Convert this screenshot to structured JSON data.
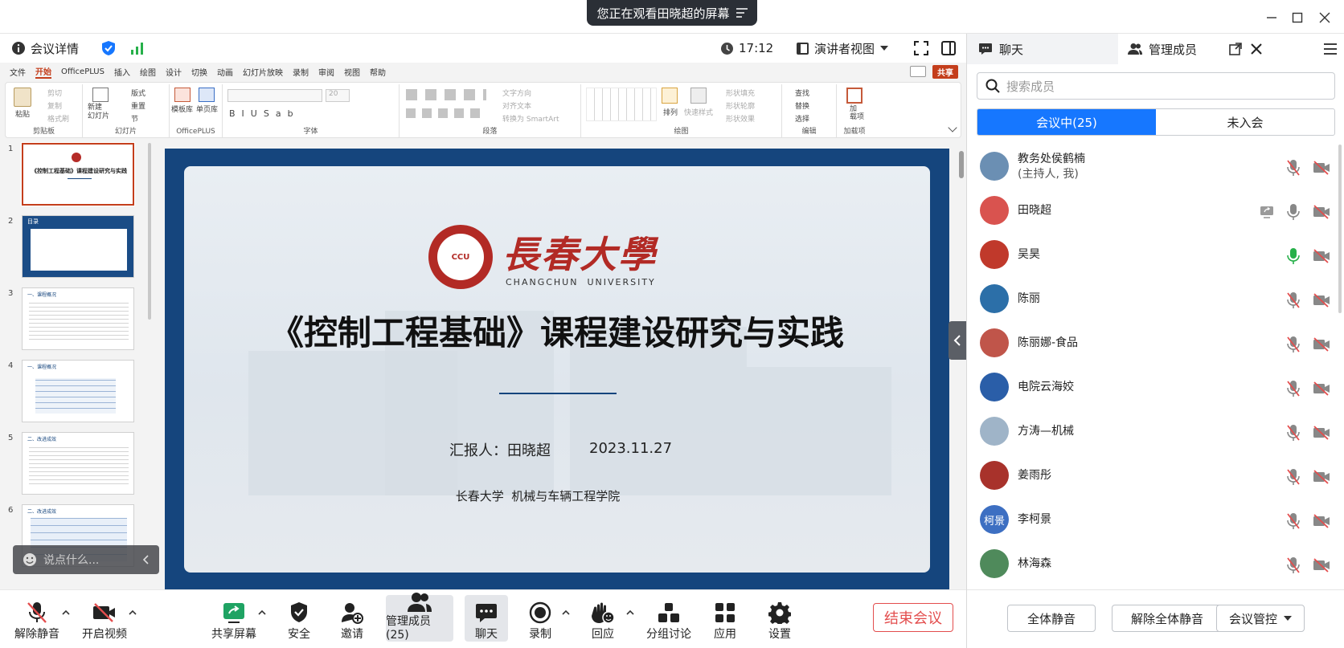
{
  "title_bar": {
    "share_banner": "您正在观看田晓超的屏幕"
  },
  "meeting_bar": {
    "details": "会议详情",
    "time": "17:12",
    "view_mode": "演讲者视图"
  },
  "ppt": {
    "menu": [
      "文件",
      "开始",
      "OfficePLUS",
      "插入",
      "绘图",
      "设计",
      "切换",
      "动画",
      "幻灯片放映",
      "录制",
      "审阅",
      "视图",
      "帮助"
    ],
    "share_button": "共享",
    "ribbon": {
      "paste": "粘贴",
      "cut": "剪切",
      "copy": "复制",
      "format_painter": "格式刷",
      "clipboard": "剪贴板",
      "new_slide": "新建\n幻灯片",
      "layout": "版式",
      "reset": "重置",
      "section": "节",
      "slides": "幻灯片",
      "template_lib": "模板库",
      "single_page_lib": "单页库",
      "officeplus": "OfficePLUS",
      "font_size": "20",
      "font": "字体",
      "text_direction": "文字方向",
      "align_text": "对齐文本",
      "convert_smartart": "转换为 SmartArt",
      "paragraph": "段落",
      "arrange": "排列",
      "quick_styles": "快速样式",
      "shape_fill": "形状填充",
      "shape_outline": "形状轮廓",
      "shape_effects": "形状效果",
      "drawing": "绘图",
      "find": "查找",
      "replace": "替换",
      "select": "选择",
      "editing": "编辑",
      "addin": "加\n载项",
      "addins": "加载项"
    },
    "thumb_numbers": [
      "1",
      "2",
      "3",
      "4",
      "5",
      "6"
    ],
    "thumb_titles": [
      "《控制工程基础》课程建设研究与实践",
      "目录",
      "一、课程概况",
      "一、课程概况",
      "二、改进成效",
      "二、改进成效"
    ],
    "slide": {
      "university_cn": "長春大學",
      "university_en": "CHANGCHUN  UNIVERSITY",
      "seal_text": "CCU",
      "title": "《控制工程基础》课程建设研究与实践",
      "reporter": "汇报人：田晓超",
      "date": "2023.11.27",
      "org": "长春大学  机械与车辆工程学院"
    },
    "chat_placeholder": "说点什么..."
  },
  "toolbar": {
    "unmute": "解除静音",
    "start_video": "开启视频",
    "share_screen": "共享屏幕",
    "security": "安全",
    "invite": "邀请",
    "members": "管理成员(25)",
    "chat": "聊天",
    "record": "录制",
    "reactions": "回应",
    "breakout": "分组讨论",
    "apps": "应用",
    "settings": "设置",
    "end": "结束会议"
  },
  "panel": {
    "tab_chat": "聊天",
    "tab_members": "管理成员",
    "search_placeholder": "搜索成员",
    "seg_in": "会议中(25)",
    "seg_out": "未入会",
    "members": [
      {
        "name": "教务处侯鹤楠",
        "sub": "(主持人, 我)",
        "avatar_color": "#6b8fb3",
        "mic": "muted",
        "screen": false
      },
      {
        "name": "田晓超",
        "sub": "",
        "avatar_color": "#d9534f",
        "mic": "on",
        "screen": true
      },
      {
        "name": "吴昊",
        "sub": "",
        "avatar_color": "#c0392b",
        "mic": "active",
        "screen": false
      },
      {
        "name": "陈丽",
        "sub": "",
        "avatar_color": "#2c6fa8",
        "mic": "muted",
        "screen": false
      },
      {
        "name": "陈丽娜-食品",
        "sub": "",
        "avatar_color": "#c0554a",
        "mic": "muted",
        "screen": false
      },
      {
        "name": "电院云海姣",
        "sub": "",
        "avatar_color": "#2a5ea8",
        "mic": "muted",
        "screen": false
      },
      {
        "name": "方涛—机械",
        "sub": "",
        "avatar_color": "#9fb4c8",
        "mic": "muted",
        "screen": false
      },
      {
        "name": "姜雨彤",
        "sub": "",
        "avatar_color": "#a8322b",
        "mic": "muted",
        "screen": false
      },
      {
        "name": "李柯景",
        "sub": "",
        "avatar_text": "柯景",
        "avatar_color": "#3d6fc2",
        "mic": "muted",
        "screen": false
      },
      {
        "name": "林海森",
        "sub": "",
        "avatar_color": "#4f8a5b",
        "mic": "muted",
        "screen": false
      }
    ],
    "mute_all": "全体静音",
    "unmute_all": "解除全体静音",
    "meeting_control": "会议管控"
  },
  "colors": {
    "accent": "#1677ff",
    "end_red": "#e34d4d",
    "slide_border": "#15457d",
    "ppt_accent": "#c43e1c"
  }
}
